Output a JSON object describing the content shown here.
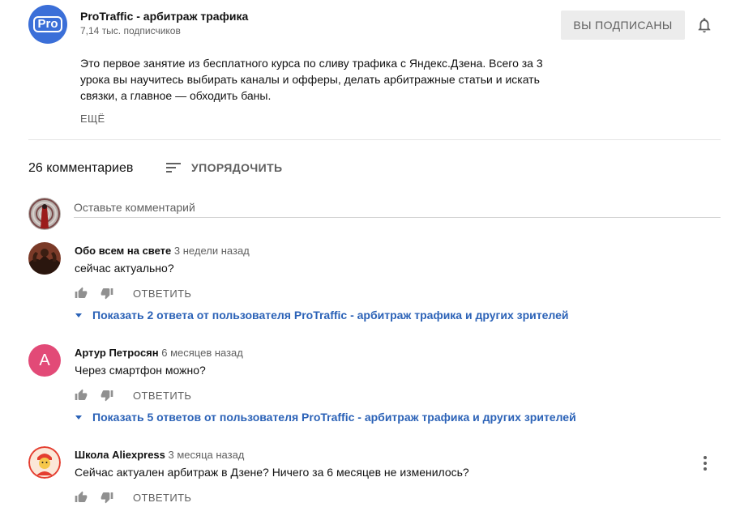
{
  "channel": {
    "logo_text": "Pro",
    "name": "ProTraffic - арбитраж трафика",
    "subscribers": "7,14 тыс. подписчиков",
    "subscribed_label": "ВЫ ПОДПИСАНЫ"
  },
  "description": {
    "text": "Это первое занятие из бесплатного курса по сливу трафика с Яндекс.Дзена. Всего за 3 урока вы научитесь выбирать каналы и офферы, делать арбитражные статьи и искать связки, а главное — обходить баны.",
    "more_label": "ЕЩЁ"
  },
  "comments_header": {
    "count_label": "26 комментариев",
    "sort_label": "УПОРЯДОЧИТЬ"
  },
  "new_comment": {
    "placeholder": "Оставьте комментарий"
  },
  "comments": [
    {
      "author": "Обо всем на свете",
      "time": "3 недели назад",
      "text": "сейчас актуально?",
      "reply_label": "ОТВЕТИТЬ",
      "replies_label": "Показать 2 ответа от пользователя ProTraffic - арбитраж трафика и других зрителей"
    },
    {
      "author": "Артур Петросян",
      "time": "6 месяцев назад",
      "avatar_letter": "А",
      "avatar_color": "#e24a77",
      "text": "Через смартфон можно?",
      "reply_label": "ОТВЕТИТЬ",
      "replies_label": "Показать 5 ответов от пользователя ProTraffic - арбитраж трафика и других зрителей"
    },
    {
      "author": "Школа Aliexpress",
      "time": "3 месяца назад",
      "text": "Сейчас актуален арбитраж в Дзене? Ничего за 6 месяцев не изменилось?",
      "reply_label": "ОТВЕТИТЬ"
    }
  ],
  "colors": {
    "link_blue": "#2b62b7",
    "channel_blue": "#3b6fd8",
    "muted_text": "#606060"
  }
}
